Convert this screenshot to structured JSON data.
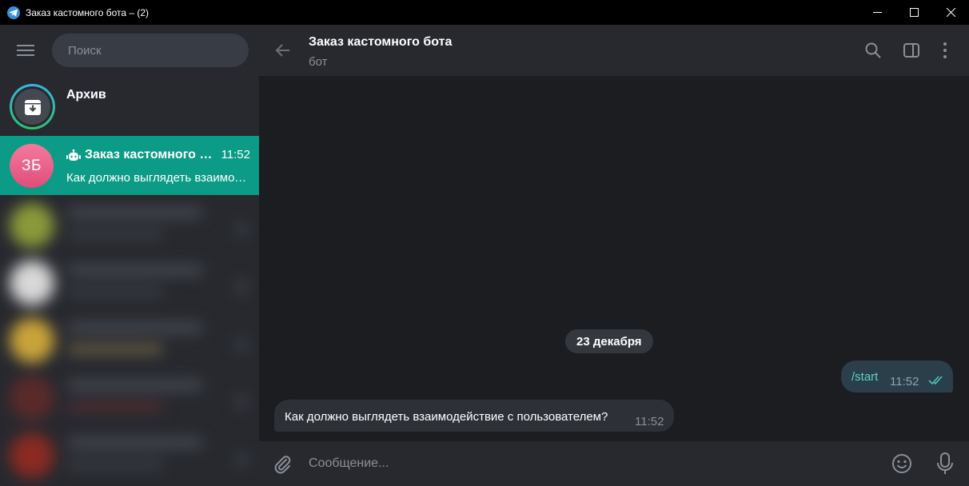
{
  "window": {
    "title": "Заказ кастомного бота – (2)"
  },
  "sidebar": {
    "search_placeholder": "Поиск",
    "archive_label": "Архив",
    "active_chat": {
      "avatar_initials": "ЗБ",
      "avatar_color": "#e95b86",
      "name": "Заказ кастомного бота",
      "time": "11:52",
      "preview": "Как должно выглядеть взаимодействие с пользователем?"
    },
    "accent_color": "#0b9b86"
  },
  "chat": {
    "title": "Заказ кастомного бота",
    "subtitle": "бот",
    "date_separator": "23 декабря",
    "messages": [
      {
        "direction": "outgoing",
        "text": "/start",
        "time": "11:52",
        "status": "read"
      },
      {
        "direction": "incoming",
        "text": "Как должно выглядеть взаимодействие с пользователем?",
        "time": "11:52"
      }
    ],
    "composer_placeholder": "Сообщение..."
  },
  "icons": [
    "telegram-icon",
    "minimize-icon",
    "maximize-icon",
    "close-icon",
    "menu-icon",
    "archive-icon",
    "bot-icon",
    "back-arrow-icon",
    "search-icon",
    "sidebar-toggle-icon",
    "more-vert-icon",
    "read-checks-icon",
    "attach-icon",
    "emoji-icon",
    "microphone-icon"
  ]
}
